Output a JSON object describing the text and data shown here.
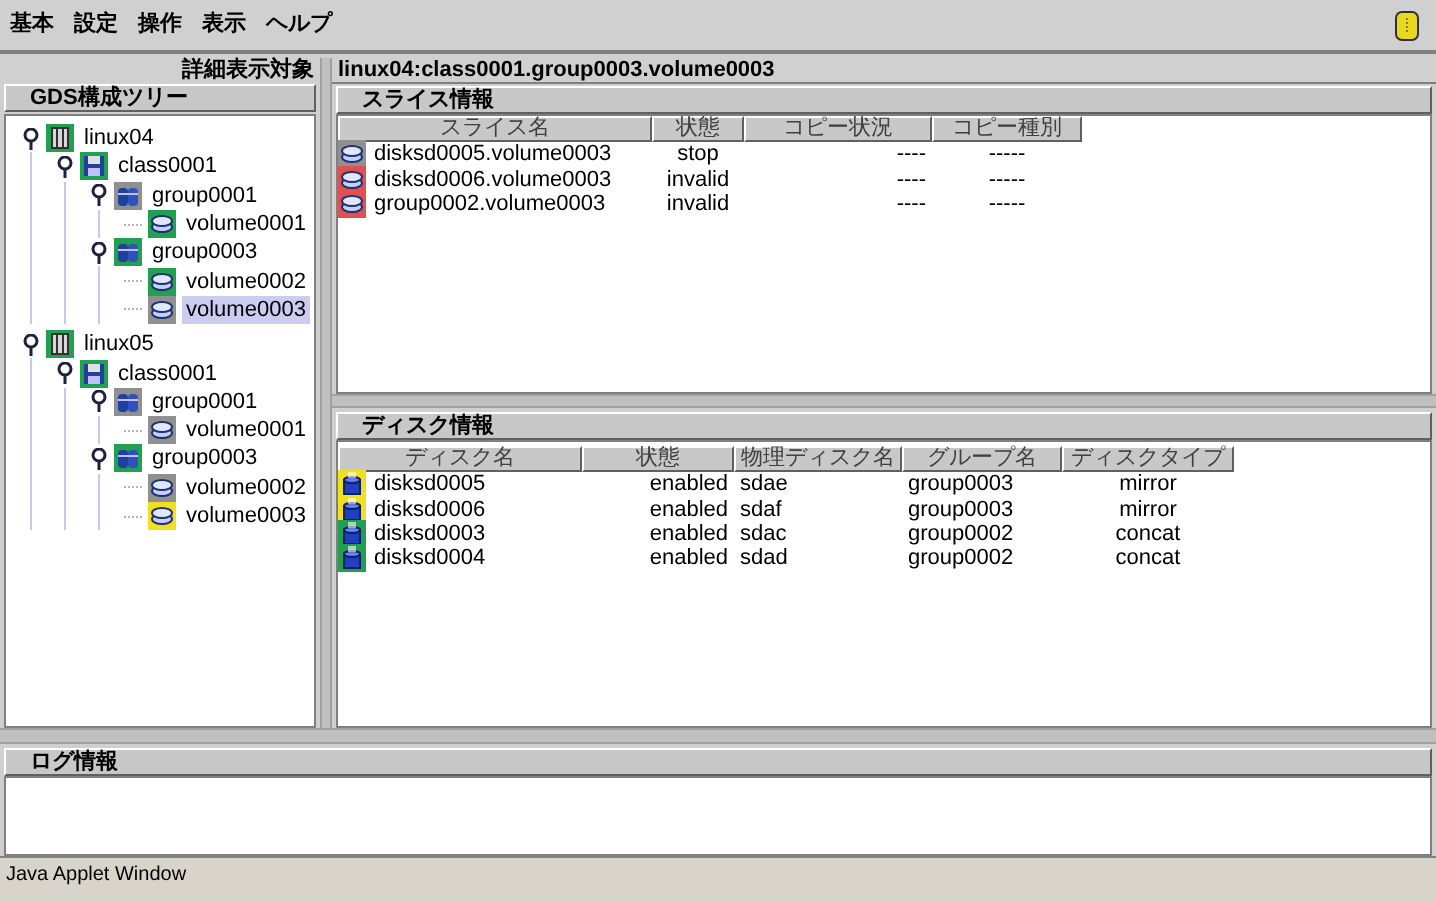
{
  "menu": [
    "基本",
    "設定",
    "操作",
    "表示",
    "ヘルプ"
  ],
  "left_pane": {
    "caption": "詳細表示対象",
    "tree_title": "GDS構成ツリー",
    "tree": [
      {
        "label": "linux04",
        "kind": "host",
        "color": "#20a050",
        "expanded": true,
        "selected": false,
        "children": [
          {
            "label": "class0001",
            "kind": "class",
            "color": "#20a050",
            "expanded": true,
            "selected": false,
            "children": [
              {
                "label": "group0001",
                "kind": "group",
                "color": "#909090",
                "expanded": true,
                "selected": false,
                "children": [
                  {
                    "label": "volume0001",
                    "kind": "volume",
                    "color": "#20a050",
                    "selected": false
                  }
                ]
              },
              {
                "label": "group0003",
                "kind": "group",
                "color": "#20a050",
                "expanded": true,
                "selected": false,
                "children": [
                  {
                    "label": "volume0002",
                    "kind": "volume",
                    "color": "#20a050",
                    "selected": false
                  },
                  {
                    "label": "volume0003",
                    "kind": "volume",
                    "color": "#909090",
                    "selected": true
                  }
                ]
              }
            ]
          }
        ]
      },
      {
        "label": "linux05",
        "kind": "host",
        "color": "#20a050",
        "expanded": true,
        "selected": false,
        "children": [
          {
            "label": "class0001",
            "kind": "class",
            "color": "#20a050",
            "expanded": true,
            "selected": false,
            "children": [
              {
                "label": "group0001",
                "kind": "group",
                "color": "#909090",
                "expanded": true,
                "selected": false,
                "children": [
                  {
                    "label": "volume0001",
                    "kind": "volume",
                    "color": "#909090",
                    "selected": false
                  }
                ]
              },
              {
                "label": "group0003",
                "kind": "group",
                "color": "#20a050",
                "expanded": true,
                "selected": false,
                "children": [
                  {
                    "label": "volume0002",
                    "kind": "volume",
                    "color": "#909090",
                    "selected": false
                  },
                  {
                    "label": "volume0003",
                    "kind": "volume",
                    "color": "#f0e020",
                    "selected": false
                  }
                ]
              }
            ]
          }
        ]
      }
    ]
  },
  "detail_path": "linux04:class0001.group0003.volume0003",
  "slice_panel": {
    "title": "スライス情報",
    "columns": [
      "スライス名",
      "状態",
      "コピー状況",
      "コピー種別"
    ],
    "rows": [
      {
        "color": "#909090",
        "cells": [
          "disksd0005.volume0003",
          "stop",
          "----",
          "-----"
        ]
      },
      {
        "color": "#e05050",
        "cells": [
          "disksd0006.volume0003",
          "invalid",
          "----",
          "-----"
        ]
      },
      {
        "color": "#e05050",
        "cells": [
          "group0002.volume0003",
          "invalid",
          "----",
          "-----"
        ]
      }
    ]
  },
  "disk_panel": {
    "title": "ディスク情報",
    "columns": [
      "ディスク名",
      "状態",
      "物理ディスク名",
      "グループ名",
      "ディスクタイプ"
    ],
    "rows": [
      {
        "color": "#f0e020",
        "cells": [
          "disksd0005",
          "enabled",
          "sdae",
          "group0003",
          "mirror"
        ]
      },
      {
        "color": "#f0e020",
        "cells": [
          "disksd0006",
          "enabled",
          "sdaf",
          "group0003",
          "mirror"
        ]
      },
      {
        "color": "#20a050",
        "cells": [
          "disksd0003",
          "enabled",
          "sdac",
          "group0002",
          "concat"
        ]
      },
      {
        "color": "#20a050",
        "cells": [
          "disksd0004",
          "enabled",
          "sdad",
          "group0002",
          "concat"
        ]
      }
    ]
  },
  "log_panel": {
    "title": "ログ情報"
  },
  "status_bar": "Java Applet Window"
}
